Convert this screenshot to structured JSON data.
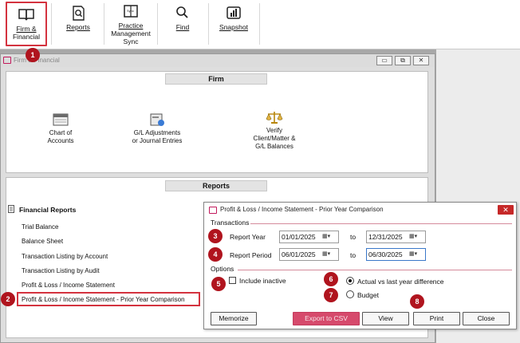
{
  "ribbon": {
    "items": [
      {
        "label1": "Firm &",
        "label2": "Financial",
        "icon": "book-icon"
      },
      {
        "label1": "Reports",
        "label2": "",
        "icon": "report-search-icon"
      },
      {
        "label1": "Practice",
        "label2": "Management",
        "label3": "Sync",
        "icon": "sync-book-icon"
      },
      {
        "label1": "Find",
        "label2": "",
        "icon": "magnifier-icon"
      },
      {
        "label1": "Snapshot",
        "label2": "",
        "icon": "chart-icon"
      }
    ]
  },
  "window": {
    "title": "Firm & Financial",
    "firm_header": "Firm",
    "firm_items": [
      {
        "line1": "Chart of",
        "line2": "Accounts",
        "line3": ""
      },
      {
        "line1": "G/L Adjustments",
        "line2": "or Journal Entries",
        "line3": ""
      },
      {
        "line1": "Verify",
        "line2": "Client/Matter &",
        "line3": "G/L Balances"
      }
    ],
    "reports_header": "Reports",
    "financial_reports_title": "Financial Reports",
    "financial_reports": [
      "Trial Balance",
      "Balance Sheet",
      "Transaction Listing by Account",
      "Transaction Listing by Audit",
      "Profit & Loss / Income Statement",
      "Profit & Loss / Income Statement - Prior Year Comparison"
    ]
  },
  "dialog": {
    "title": "Profit & Loss / Income Statement - Prior Year Comparison",
    "close": "✕",
    "transactions_label": "Transactions",
    "report_year_label": "Report Year",
    "report_year_from": "01/01/2025",
    "report_year_to": "12/31/2025",
    "report_period_label": "Report Period",
    "report_period_from": "06/01/2025",
    "report_period_to": "06/30/2025",
    "to_label": "to",
    "options_label": "Options",
    "include_inactive": "Include inactive",
    "opt_actual": "Actual vs last year difference",
    "opt_budget": "Budget",
    "buttons": {
      "memorize": "Memorize",
      "export": "Export to CSV",
      "view": "View",
      "print": "Print",
      "close": "Close"
    }
  },
  "callouts": [
    "1",
    "2",
    "3",
    "4",
    "5",
    "6",
    "7",
    "8"
  ],
  "colors": {
    "accent": "#d4333f",
    "callout": "#b0141e",
    "export_button": "#d64a6c"
  }
}
